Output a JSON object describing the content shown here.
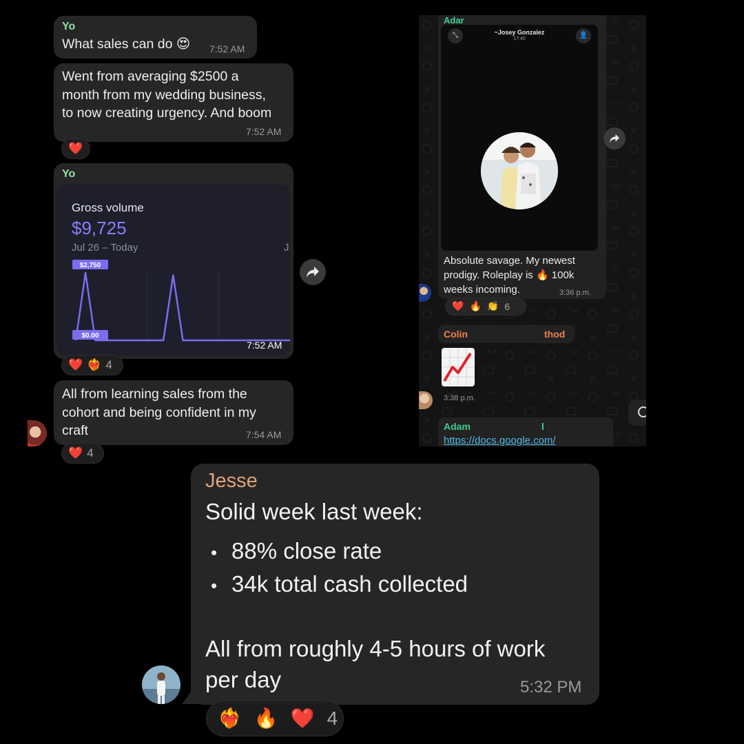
{
  "left_chat": {
    "msg1": {
      "sender": "Yo",
      "text": "What sales can do",
      "emoji": "😍",
      "time": "7:52 AM"
    },
    "msg2": {
      "lines": [
        "Went from averaging $2500 a",
        "month from my wedding business,",
        "to now creating urgency. And boom"
      ],
      "time": "7:52 AM",
      "reactions": [
        "❤️"
      ]
    },
    "msg3": {
      "sender": "Yo",
      "time": "7:52 AM",
      "reactions": [
        "❤️",
        "❤️‍🔥"
      ],
      "reaction_count": "4",
      "card": {
        "title": "Gross volume",
        "amount": "$9,725",
        "range": "Jul 26 – Today",
        "edge_label": "J",
        "max_tag": "$2,750",
        "min_tag": "$0.00"
      }
    },
    "msg4": {
      "lines": [
        "All from learning sales from the",
        "cohort and being confident in my",
        "craft"
      ],
      "time": "7:54 AM",
      "reactions": [
        "❤️"
      ],
      "reaction_count": "4"
    }
  },
  "chart_data": {
    "type": "line",
    "title": "Gross volume",
    "x": [
      0,
      1,
      2,
      3,
      4,
      5,
      6,
      7,
      8,
      9,
      10,
      11,
      12,
      13,
      14,
      15,
      16,
      17,
      18,
      19,
      20,
      21,
      22
    ],
    "values": [
      0,
      2750,
      0,
      0,
      0,
      0,
      0,
      0,
      0,
      0,
      2650,
      0,
      0,
      0,
      0,
      0,
      0,
      0,
      0,
      0,
      0,
      0,
      0
    ],
    "ylim": [
      0,
      2750
    ],
    "y_tick_labels": [
      "$0.00",
      "$2,750"
    ],
    "color": "#7c6cf0"
  },
  "right_panel": {
    "top_sender": "Adar",
    "video_title": "~Josey Gonzalez",
    "video_sub": "17:40",
    "msg_lines": [
      "Absolute savage. My newest",
      "prodigy. Roleplay is 🔥 100k",
      "weeks incoming."
    ],
    "msg_time": "3:36 p.m.",
    "reactions": [
      "❤️",
      "🔥",
      "👏"
    ],
    "reaction_count": "6",
    "colin_sender": "Colin",
    "colin_tail": "thod",
    "colin_time": "3:38 p.m.",
    "adam_sender": "Adam",
    "adam_tail": "l",
    "adam_link": "https://docs.google.com/"
  },
  "jesse": {
    "sender": "Jesse",
    "intro": "Solid week last week:",
    "bullets": [
      "88% close rate",
      "34k total cash collected"
    ],
    "closing_lines": [
      "All from roughly 4-5 hours of work",
      "per day"
    ],
    "time": "5:32 PM",
    "reactions": [
      "❤️‍🔥",
      "🔥",
      "❤️"
    ],
    "reaction_count": "4"
  },
  "colors": {
    "bubble": "#262626",
    "sender_green": "#8fe3a0",
    "sender_jesse": "#e0a37a",
    "chart_line": "#7c6cf0",
    "link": "#4fb7e3"
  }
}
